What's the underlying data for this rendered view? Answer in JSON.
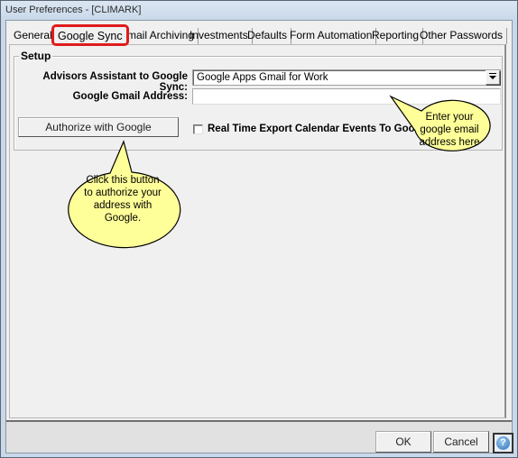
{
  "window": {
    "title": "User Preferences -  [CLIMARK]"
  },
  "tabs": [
    {
      "label": "General",
      "active": false
    },
    {
      "label": "Google Sync",
      "active": true
    },
    {
      "label": "Email Archiving",
      "active": false
    },
    {
      "label": "Investments",
      "active": false
    },
    {
      "label": "Defaults",
      "active": false
    },
    {
      "label": "Form Automation",
      "active": false
    },
    {
      "label": "Reporting",
      "active": false
    },
    {
      "label": "Other Passwords",
      "active": false
    }
  ],
  "setup": {
    "group_label": "Setup",
    "sync_label": "Advisors Assistant to Google Sync:",
    "sync_value": "Google Apps Gmail for Work",
    "email_label": "Google Gmail Address:",
    "email_value": "",
    "authorize_button": "Authorize with Google",
    "realtime_checkbox_label": "Real Time Export Calendar Events To Google",
    "realtime_checked": false
  },
  "callouts": {
    "email_hint": [
      "Enter your",
      "google email",
      "address here"
    ],
    "authorize_hint": [
      "Click this button",
      "to authorize your",
      "address with",
      "Google."
    ]
  },
  "footer": {
    "ok_button": "OK",
    "cancel_button": "Cancel",
    "help_icon": "question-mark-icon",
    "help_glyph": "?"
  },
  "colors": {
    "callout_fill": "#ffff99",
    "active_tab_highlight": "#e01b1b"
  }
}
